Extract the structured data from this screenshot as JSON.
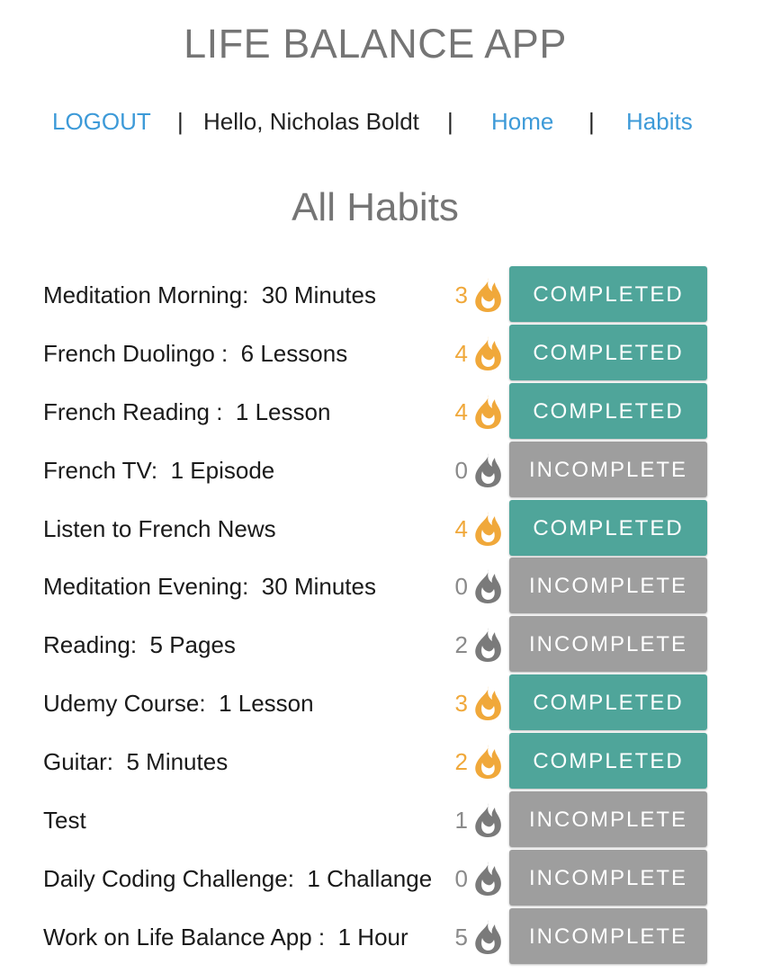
{
  "app": {
    "title": "LIFE BALANCE APP"
  },
  "nav": {
    "logout_label": "LOGOUT",
    "separator": "|",
    "greeting": "Hello, Nicholas Boldt",
    "home_label": "Home",
    "habits_label": "Habits"
  },
  "page": {
    "heading": "All Habits"
  },
  "colors": {
    "link": "#3d9ad8",
    "completed": "#4fa59a",
    "incomplete": "#9e9e9e",
    "flame_active": "#f0a83a",
    "flame_inactive": "#7a7a7a"
  },
  "icons": {
    "streak": "flame-icon"
  },
  "habits": [
    {
      "name": "Meditation Morning:  30 Minutes",
      "streak": "3",
      "status": "COMPLETED",
      "completed": true
    },
    {
      "name": "French Duolingo :  6 Lessons",
      "streak": "4",
      "status": "COMPLETED",
      "completed": true
    },
    {
      "name": "French Reading :  1 Lesson",
      "streak": "4",
      "status": "COMPLETED",
      "completed": true
    },
    {
      "name": "French TV:  1 Episode",
      "streak": "0",
      "status": "INCOMPLETE",
      "completed": false
    },
    {
      "name": "Listen to French News",
      "streak": "4",
      "status": "COMPLETED",
      "completed": true
    },
    {
      "name": "Meditation Evening:  30 Minutes",
      "streak": "0",
      "status": "INCOMPLETE",
      "completed": false
    },
    {
      "name": "Reading:  5 Pages",
      "streak": "2",
      "status": "INCOMPLETE",
      "completed": false
    },
    {
      "name": "Udemy Course:  1 Lesson",
      "streak": "3",
      "status": "COMPLETED",
      "completed": true
    },
    {
      "name": "Guitar:  5 Minutes",
      "streak": "2",
      "status": "COMPLETED",
      "completed": true
    },
    {
      "name": "Test",
      "streak": "1",
      "status": "INCOMPLETE",
      "completed": false
    },
    {
      "name": "Daily Coding Challenge:  1 Challange",
      "streak": "0",
      "status": "INCOMPLETE",
      "completed": false
    },
    {
      "name": "Work on Life Balance App :  1 Hour",
      "streak": "5",
      "status": "INCOMPLETE",
      "completed": false
    }
  ]
}
